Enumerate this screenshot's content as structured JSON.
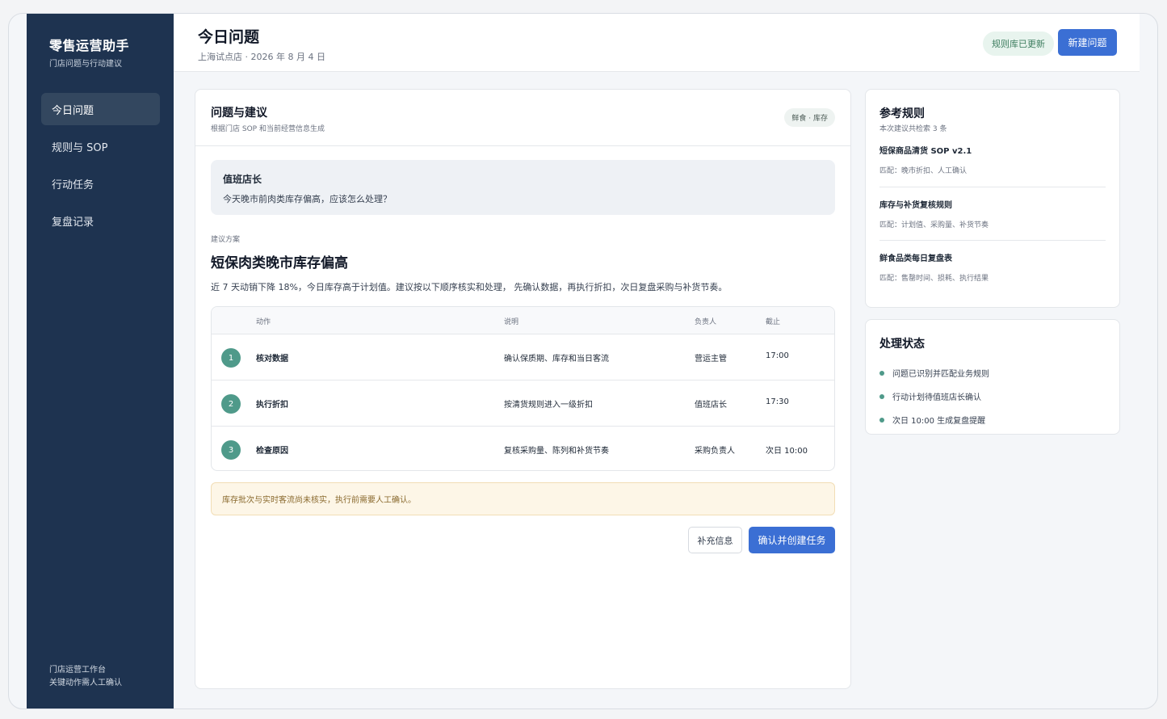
{
  "sidebar": {
    "title": "零售运营助手",
    "subtitle": "门店问题与行动建议",
    "items": [
      {
        "label": "今日问题"
      },
      {
        "label": "规则与 SOP"
      },
      {
        "label": "行动任务"
      },
      {
        "label": "复盘记录"
      }
    ],
    "footer_line1": "门店运营工作台",
    "footer_line2": "关键动作需人工确认"
  },
  "header": {
    "title": "今日问题",
    "subtitle": "上海试点店 · 2026 年 8 月 4 日",
    "badge": "规则库已更新",
    "new_button": "新建问题"
  },
  "main_card": {
    "title": "问题与建议",
    "subtitle": "根据门店 SOP 和当前经营信息生成",
    "tag": "鲜食 · 库存",
    "question": {
      "role": "值班店长",
      "text": "今天晚市前肉类库存偏高，应该怎么处理？"
    },
    "suggestion_label": "建议方案",
    "suggestion_title": "短保肉类晚市库存偏高",
    "suggestion_desc": "近 7 天动销下降 18%，今日库存高于计划值。建议按以下顺序核实和处理， 先确认数据，再执行折扣，次日复盘采购与补货节奏。",
    "table": {
      "headers": {
        "action": "动作",
        "desc": "说明",
        "owner": "负责人",
        "due": "截止"
      },
      "rows": [
        {
          "step": "1",
          "action": "核对数据",
          "desc": "确认保质期、库存和当日客流",
          "owner": "营运主管",
          "due": "17:00"
        },
        {
          "step": "2",
          "action": "执行折扣",
          "desc": "按清货规则进入一级折扣",
          "owner": "值班店长",
          "due": "17:30"
        },
        {
          "step": "3",
          "action": "检查原因",
          "desc": "复核采购量、陈列和补货节奏",
          "owner": "采购负责人",
          "due": "次日 10:00"
        }
      ]
    },
    "warning": "库存批次与实时客流尚未核实，执行前需要人工确认。",
    "more_button": "补充信息",
    "confirm_button": "确认并创建任务"
  },
  "rules_card": {
    "title": "参考规则",
    "subtitle": "本次建议共检索 3 条",
    "rules": [
      {
        "name": "短保商品清货 SOP v2.1",
        "match": "匹配：晚市折扣、人工确认"
      },
      {
        "name": "库存与补货复核规则",
        "match": "匹配：计划值、采购量、补货节奏"
      },
      {
        "name": "鲜食品类每日复盘表",
        "match": "匹配：售罄时间、损耗、执行结果"
      }
    ]
  },
  "status_card": {
    "title": "处理状态",
    "items": [
      {
        "text": "问题已识别并匹配业务规则"
      },
      {
        "text": "行动计划待值班店长确认"
      },
      {
        "text": "次日 10:00 生成复盘提醒"
      }
    ]
  },
  "colors": {
    "sidebar_bg": "#1e3350",
    "accent": "#3b6fd4",
    "step_green": "#4f9a8a",
    "warning_bg": "#fdf6e7"
  }
}
